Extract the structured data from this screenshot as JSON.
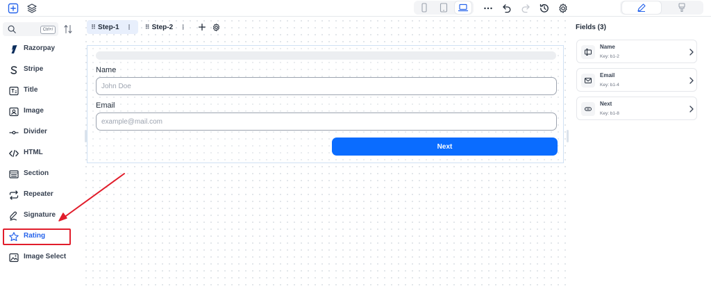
{
  "toolbar": {
    "add_icon": "plus-square-icon",
    "layers_icon": "layers-icon",
    "devices": [
      "mobile-icon",
      "tablet-icon",
      "laptop-icon"
    ],
    "active_device": "laptop",
    "actions": [
      "more-icon",
      "undo-icon",
      "redo-icon",
      "history-icon",
      "settings-icon"
    ],
    "modes": [
      "edit-icon",
      "paint-icon"
    ],
    "active_mode": "edit",
    "accent_color": "#2563eb"
  },
  "sidebar": {
    "search_placeholder": "",
    "shortcut": "Ctrl+/",
    "items": [
      {
        "label": "Razorpay",
        "icon": "razorpay-icon"
      },
      {
        "label": "Stripe",
        "icon": "stripe-icon"
      },
      {
        "label": "Title",
        "icon": "title-icon"
      },
      {
        "label": "Image",
        "icon": "image-icon"
      },
      {
        "label": "Divider",
        "icon": "divider-icon"
      },
      {
        "label": "HTML",
        "icon": "code-icon"
      },
      {
        "label": "Section",
        "icon": "section-icon"
      },
      {
        "label": "Repeater",
        "icon": "repeat-icon"
      },
      {
        "label": "Signature",
        "icon": "signature-icon"
      },
      {
        "label": "Rating",
        "icon": "star-icon",
        "highlighted": true
      },
      {
        "label": "Image Select",
        "icon": "image-select-icon"
      }
    ],
    "highlight_color": "#e11d2b"
  },
  "canvas": {
    "tabs": [
      {
        "label": "Step-1",
        "active": true
      },
      {
        "label": "Step-2",
        "active": false
      }
    ],
    "form": {
      "fields": [
        {
          "label": "Name",
          "placeholder": "John Doe"
        },
        {
          "label": "Email",
          "placeholder": "example@mail.com"
        }
      ],
      "button_label": "Next",
      "button_color": "#0a6cff"
    }
  },
  "right_panel": {
    "title": "Fields (3)",
    "fields": [
      {
        "name": "Name",
        "key": "Key: b1-2",
        "icon": "text-field-icon"
      },
      {
        "name": "Email",
        "key": "Key: b1-4",
        "icon": "mail-icon"
      },
      {
        "name": "Next",
        "key": "Key: b1-8",
        "icon": "button-icon"
      }
    ]
  }
}
